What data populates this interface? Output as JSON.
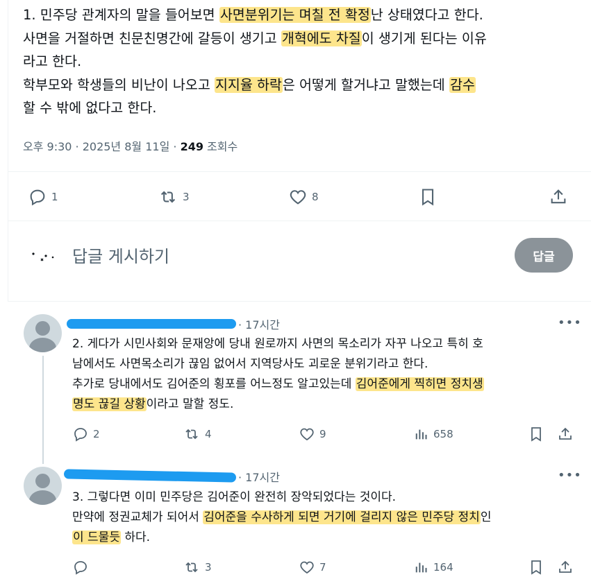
{
  "main_post": {
    "line1_a": "1. 민주당 관계자의 말을 들어보면 ",
    "line1_hl": "사면분위기는 며칠 전 확정",
    "line1_b": "난 상태였다고 한다.",
    "line2_a": "사면을 거절하면 친문친명간에 갈등이 생기고 ",
    "line2_hl": "개혁에도 차질",
    "line2_b": "이 생기게 된다는 이유",
    "line3": "라고 한다.",
    "line4_a": " 학부모와 학생들의 비난이 나오고 ",
    "line4_hl": "지지율 하락",
    "line4_b": "은 어떻게 할거냐고 말했는데 ",
    "line4_hl2": "감수",
    "line5": "할 수 밖에 없다고 한다.",
    "meta_time": "오후 9:30 · 2025년 8월 11일 · ",
    "meta_views": "249",
    "meta_views_label": " 조회수",
    "reply_count": "1",
    "repost_count": "3",
    "like_count": "8"
  },
  "compose": {
    "placeholder": "답글 게시하기",
    "button_label": "답글"
  },
  "replies": [
    {
      "time": "· 17시간",
      "line1": "2. 게다가 시민사회와 문재앙에 당내 원로까지 사면의 목소리가 자꾸 나오고 특히 호",
      "line2": "남에서도 사면목소리가 끊임 없어서 지역당사도 괴로운 분위기라고 한다.",
      "line3_a": "추가로 당내에서도 김어준의 횡포를 어느정도 알고있는데 ",
      "line3_hl": "김어준에게 찍히면 정치생",
      "line4_hl": "명도 끊길 상황",
      "line4_b": "이라고 말할 정도.",
      "reply_count": "2",
      "repost_count": "4",
      "like_count": "9",
      "view_count": "658"
    },
    {
      "time": "· 17시간",
      "line1": "3. 그렇다면 이미 민주당은 김어준이 완전히 장악되었다는 것이다.",
      "line2_a": "만약에 정권교체가 되어서 ",
      "line2_hl": "김어준을 수사하게 되면 거기에 걸리지 않은 민주당 정치",
      "line2_b": "인",
      "line3_hl": "이 드물듯",
      "line3_b": " 하다.",
      "repost_count": "3",
      "like_count": "7",
      "view_count": "164"
    }
  ],
  "colors": {
    "highlight": "#fde58c",
    "redaction": "#1d9bf0",
    "muted": "#536471",
    "button": "#8b9399"
  }
}
